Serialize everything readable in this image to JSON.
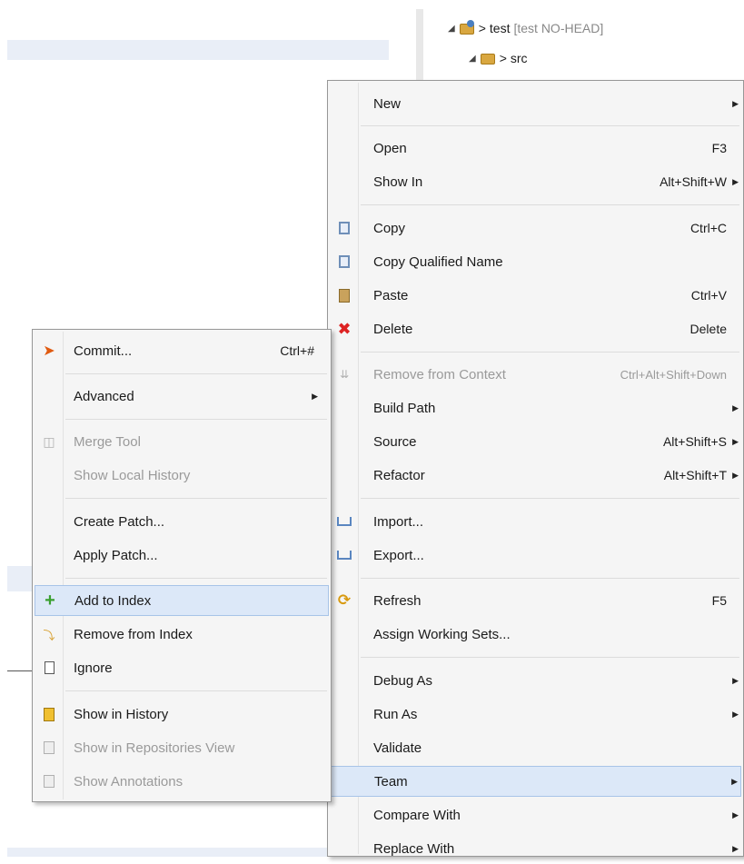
{
  "tree": {
    "project_name": "test",
    "project_decoration": "[test NO-HEAD]",
    "src_name": "src",
    "prefix": ">"
  },
  "main_menu": {
    "items": [
      {
        "label": "New",
        "accel": "",
        "submenu": true,
        "disabled": false,
        "icon": ""
      },
      {
        "label": "Open",
        "accel": "F3",
        "submenu": false,
        "disabled": false,
        "icon": ""
      },
      {
        "label": "Show In",
        "accel": "Alt+Shift+W",
        "submenu": true,
        "disabled": false,
        "icon": ""
      },
      {
        "label": "Copy",
        "accel": "Ctrl+C",
        "submenu": false,
        "disabled": false,
        "icon": "copy-icon"
      },
      {
        "label": "Copy Qualified Name",
        "accel": "",
        "submenu": false,
        "disabled": false,
        "icon": "copy-qualified-name-icon"
      },
      {
        "label": "Paste",
        "accel": "Ctrl+V",
        "submenu": false,
        "disabled": false,
        "icon": "paste-icon"
      },
      {
        "label": "Delete",
        "accel": "Delete",
        "submenu": false,
        "disabled": false,
        "icon": "delete-icon"
      },
      {
        "label": "Remove from Context",
        "accel": "Ctrl+Alt+Shift+Down",
        "submenu": false,
        "disabled": true,
        "icon": "remove-from-context-icon"
      },
      {
        "label": "Build Path",
        "accel": "",
        "submenu": true,
        "disabled": false,
        "icon": ""
      },
      {
        "label": "Source",
        "accel": "Alt+Shift+S",
        "submenu": true,
        "disabled": false,
        "icon": ""
      },
      {
        "label": "Refactor",
        "accel": "Alt+Shift+T",
        "submenu": true,
        "disabled": false,
        "icon": ""
      },
      {
        "label": "Import...",
        "accel": "",
        "submenu": false,
        "disabled": false,
        "icon": "import-icon"
      },
      {
        "label": "Export...",
        "accel": "",
        "submenu": false,
        "disabled": false,
        "icon": "export-icon"
      },
      {
        "label": "Refresh",
        "accel": "F5",
        "submenu": false,
        "disabled": false,
        "icon": "refresh-icon"
      },
      {
        "label": "Assign Working Sets...",
        "accel": "",
        "submenu": false,
        "disabled": false,
        "icon": ""
      },
      {
        "label": "Debug As",
        "accel": "",
        "submenu": true,
        "disabled": false,
        "icon": ""
      },
      {
        "label": "Run As",
        "accel": "",
        "submenu": true,
        "disabled": false,
        "icon": ""
      },
      {
        "label": "Validate",
        "accel": "",
        "submenu": false,
        "disabled": false,
        "icon": ""
      },
      {
        "label": "Team",
        "accel": "",
        "submenu": true,
        "disabled": false,
        "icon": "",
        "highlighted": true
      },
      {
        "label": "Compare With",
        "accel": "",
        "submenu": true,
        "disabled": false,
        "icon": ""
      },
      {
        "label": "Replace With",
        "accel": "",
        "submenu": true,
        "disabled": false,
        "icon": ""
      }
    ]
  },
  "team_menu": {
    "items": [
      {
        "label": "Commit...",
        "accel": "Ctrl+#",
        "submenu": false,
        "disabled": false,
        "icon": "commit-icon"
      },
      {
        "label": "Advanced",
        "accel": "",
        "submenu": true,
        "disabled": false,
        "icon": ""
      },
      {
        "label": "Merge Tool",
        "accel": "",
        "submenu": false,
        "disabled": true,
        "icon": "merge-tool-icon"
      },
      {
        "label": "Show Local History",
        "accel": "",
        "submenu": false,
        "disabled": true,
        "icon": ""
      },
      {
        "label": "Create Patch...",
        "accel": "",
        "submenu": false,
        "disabled": false,
        "icon": ""
      },
      {
        "label": "Apply Patch...",
        "accel": "",
        "submenu": false,
        "disabled": false,
        "icon": ""
      },
      {
        "label": "Add to Index",
        "accel": "",
        "submenu": false,
        "disabled": false,
        "icon": "add-to-index-icon",
        "highlighted": true
      },
      {
        "label": "Remove from Index",
        "accel": "",
        "submenu": false,
        "disabled": false,
        "icon": "remove-from-index-icon"
      },
      {
        "label": "Ignore",
        "accel": "",
        "submenu": false,
        "disabled": false,
        "icon": "ignore-icon"
      },
      {
        "label": "Show in History",
        "accel": "",
        "submenu": false,
        "disabled": false,
        "icon": "show-in-history-icon"
      },
      {
        "label": "Show in Repositories View",
        "accel": "",
        "submenu": false,
        "disabled": true,
        "icon": "show-in-repositories-icon"
      },
      {
        "label": "Show Annotations",
        "accel": "",
        "submenu": false,
        "disabled": true,
        "icon": "show-annotations-icon"
      }
    ]
  },
  "colors": {
    "highlight_bg": "#dce8f8",
    "menu_bg": "#f5f5f5",
    "disabled_text": "#9a9a9a"
  }
}
